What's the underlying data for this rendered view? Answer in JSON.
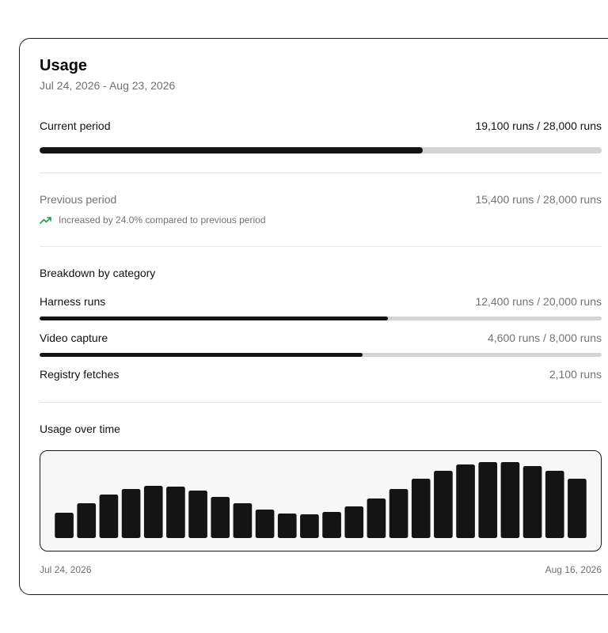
{
  "header": {
    "title": "Usage",
    "date_range": "Jul 24, 2026 - Aug 23, 2026"
  },
  "current_period": {
    "label": "Current period",
    "value_text": "19,100 runs / 28,000 runs",
    "fraction": 0.682
  },
  "previous_period": {
    "label": "Previous period",
    "value_text": "15,400 runs / 28,000 runs",
    "trend_icon": "trending-up-icon",
    "trend_text": "Increased by 24.0% compared to previous period",
    "trend_color": "#16a34a"
  },
  "breakdown": {
    "heading": "Breakdown by category",
    "items": [
      {
        "label": "Harness runs",
        "value_text": "12,400 runs / 20,000 runs",
        "fraction": 0.62
      },
      {
        "label": "Video capture",
        "value_text": "4,600 runs / 8,000 runs",
        "fraction": 0.575
      },
      {
        "label": "Registry fetches",
        "value_text": "2,100 runs"
      }
    ]
  },
  "usage_over_time": {
    "heading": "Usage over time",
    "start_label": "Jul 24, 2026",
    "end_label": "Aug 16, 2026"
  },
  "colors": {
    "bar_fill": "#141414",
    "bar_track": "#d4d4d4",
    "chart_background": "#f7f7f7"
  },
  "chart_data": {
    "type": "bar",
    "title": "",
    "xlabel": "",
    "ylabel": "",
    "x_range": [
      "Jul 24, 2026",
      "Aug 16, 2026"
    ],
    "values": [
      32,
      44,
      55,
      62,
      66,
      65,
      60,
      52,
      44,
      36,
      31,
      30,
      33,
      40,
      50,
      62,
      75,
      85,
      93,
      96,
      96,
      91,
      85,
      75
    ],
    "ylim": [
      0,
      100
    ],
    "grid": false
  }
}
